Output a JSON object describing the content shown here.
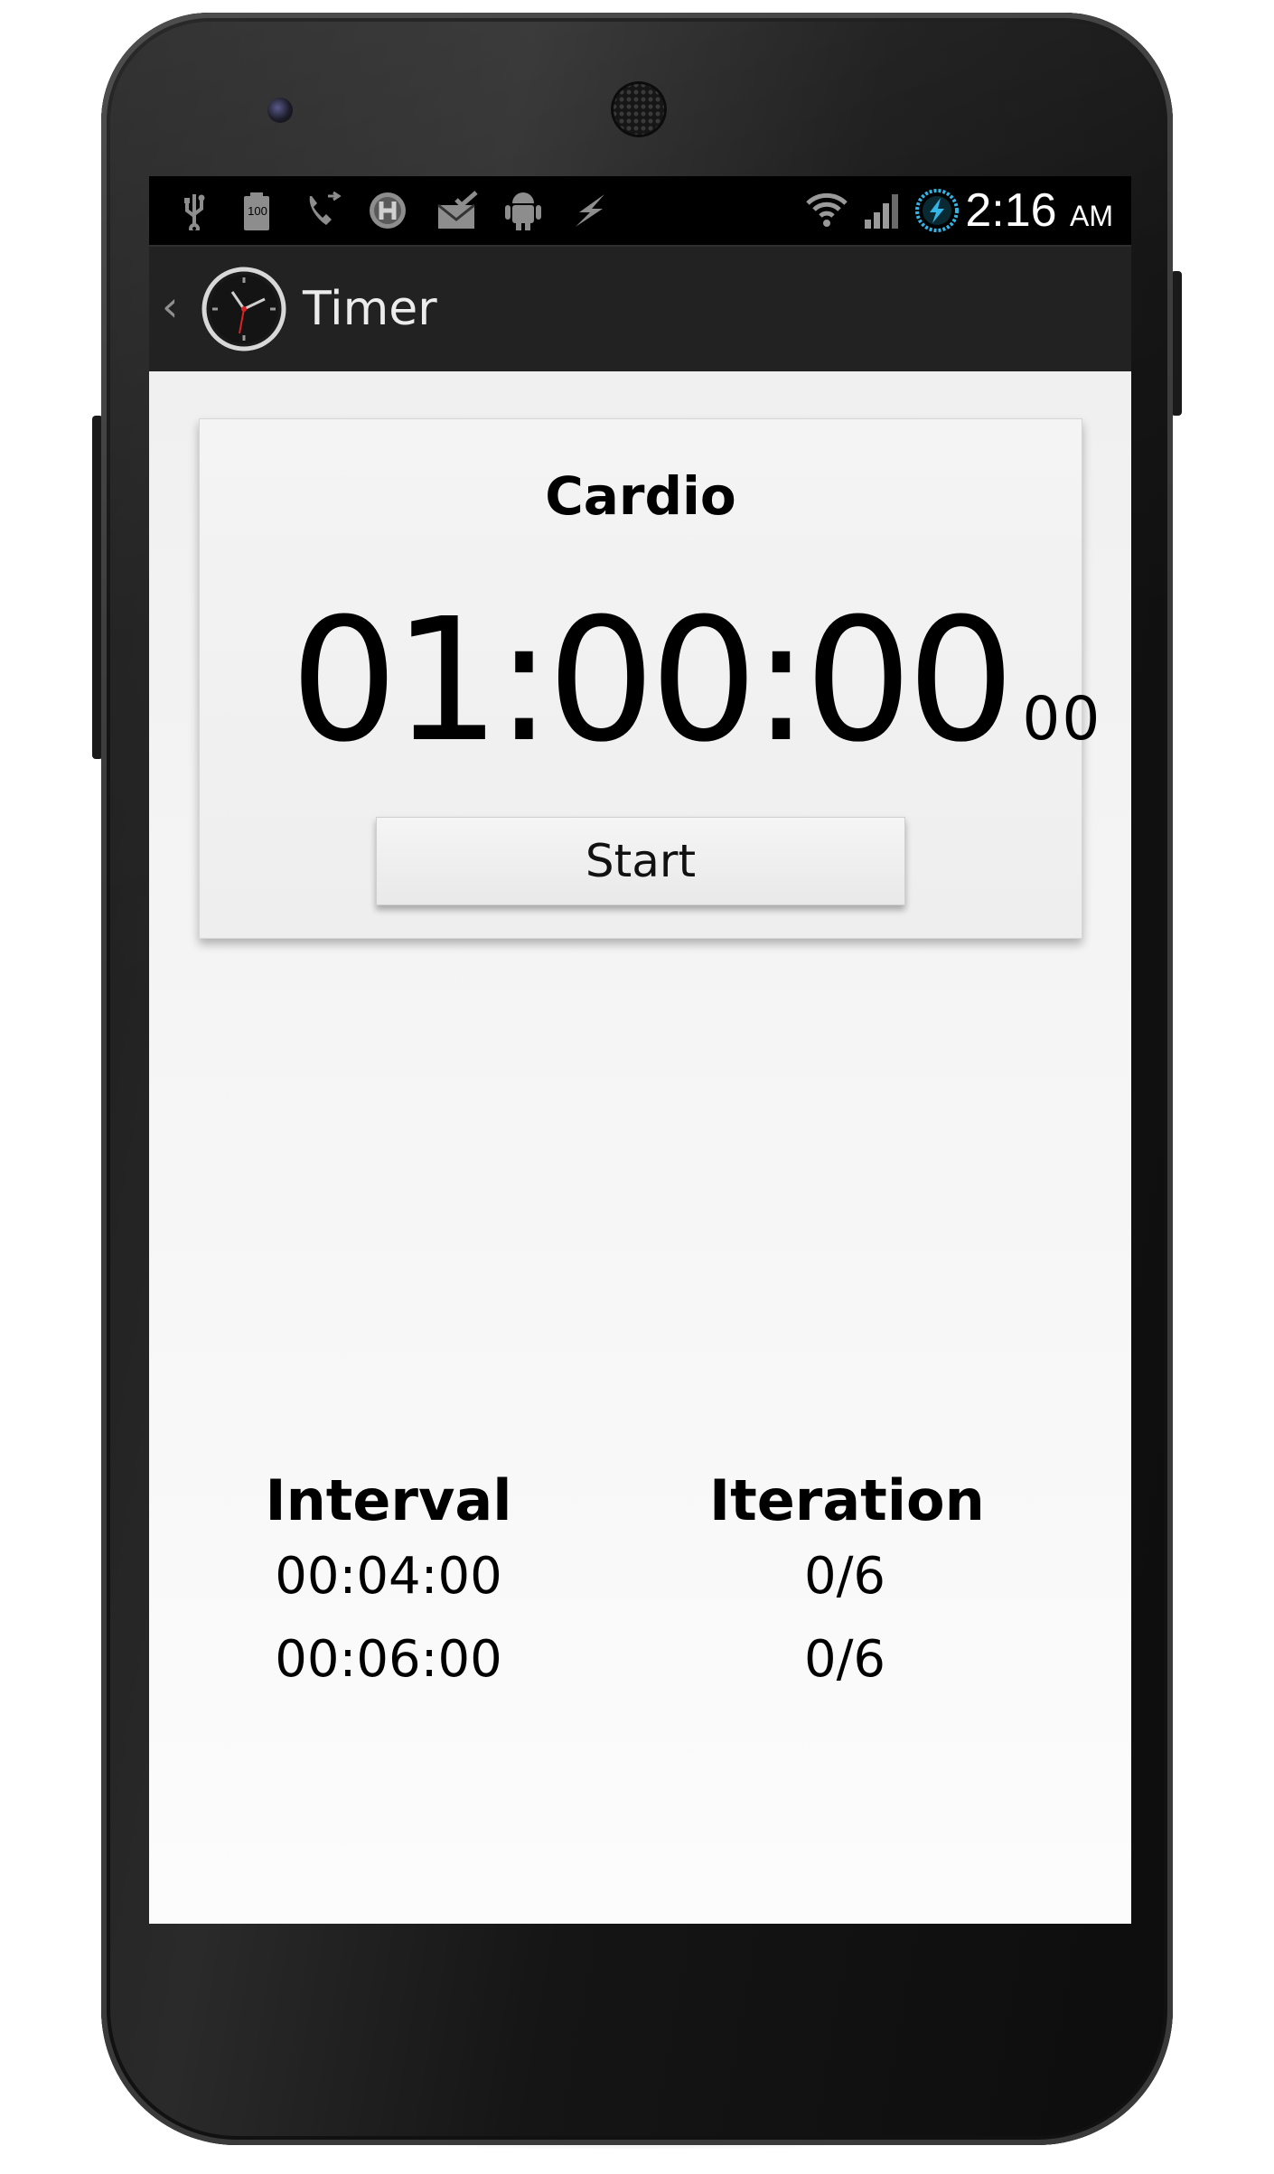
{
  "status_bar": {
    "icons": [
      "usb-icon",
      "battery-full-icon",
      "phone-call-icon",
      "h-badge-icon",
      "mail-check-icon",
      "android-icon",
      "flash-icon",
      "wifi-icon",
      "signal-icon",
      "charging-ring-icon"
    ],
    "battery_label": "100",
    "time": "2:16",
    "ampm": "AM"
  },
  "action_bar": {
    "title": "Timer",
    "icon": "clock-icon"
  },
  "timer": {
    "name": "Cardio",
    "value": "01:00:00",
    "hundredths": "00",
    "start_label": "Start"
  },
  "intervals": {
    "interval_header": "Interval",
    "iteration_header": "Iteration",
    "rows": [
      {
        "interval": "00:04:00",
        "iteration": "0/6"
      },
      {
        "interval": "00:06:00",
        "iteration": "0/6"
      }
    ]
  },
  "colors": {
    "accent": "#33b5e5",
    "screen_bg": "#f3f3f3",
    "action_bar": "#222222"
  }
}
